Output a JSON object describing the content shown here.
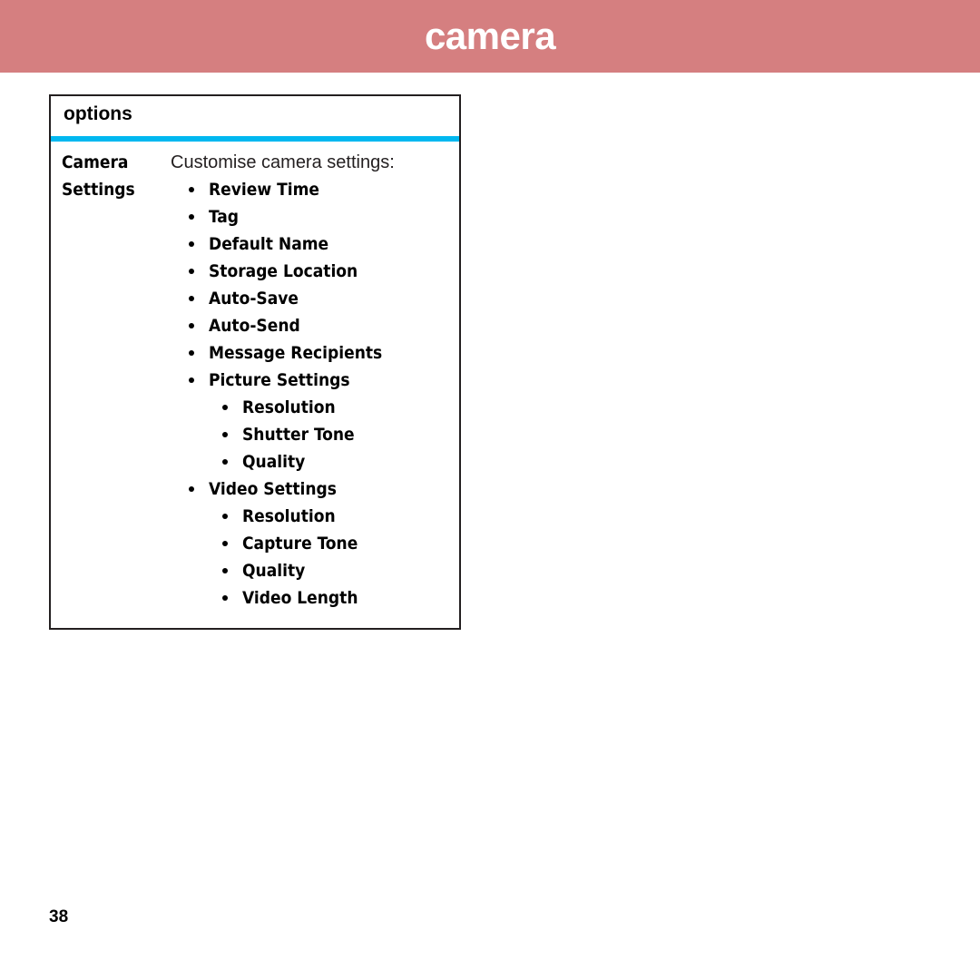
{
  "banner": {
    "title": "camera",
    "background_color": "#d57f80",
    "text_color": "#ffffff"
  },
  "options_table": {
    "header_label": "options",
    "accent_rule_color": "#00b8f0",
    "border_color": "#231f20",
    "row": {
      "label_lines": [
        "Camera",
        "Settings"
      ],
      "intro_text": "Customise camera settings:",
      "items": [
        {
          "label": "Review Time",
          "level": 1
        },
        {
          "label": "Tag",
          "level": 1
        },
        {
          "label": "Default Name",
          "level": 1
        },
        {
          "label": "Storage Location",
          "level": 1
        },
        {
          "label": "Auto-Save",
          "level": 1
        },
        {
          "label": "Auto-Send",
          "level": 1
        },
        {
          "label": "Message Recipients",
          "level": 1
        },
        {
          "label": "Picture Settings",
          "level": 1
        },
        {
          "label": "Resolution",
          "level": 2
        },
        {
          "label": "Shutter Tone",
          "level": 2
        },
        {
          "label": "Quality",
          "level": 2
        },
        {
          "label": "Video Settings",
          "level": 1
        },
        {
          "label": "Resolution",
          "level": 2
        },
        {
          "label": "Capture Tone",
          "level": 2
        },
        {
          "label": "Quality",
          "level": 2
        },
        {
          "label": "Video Length",
          "level": 2
        }
      ]
    }
  },
  "footer": {
    "page_number": "38"
  }
}
